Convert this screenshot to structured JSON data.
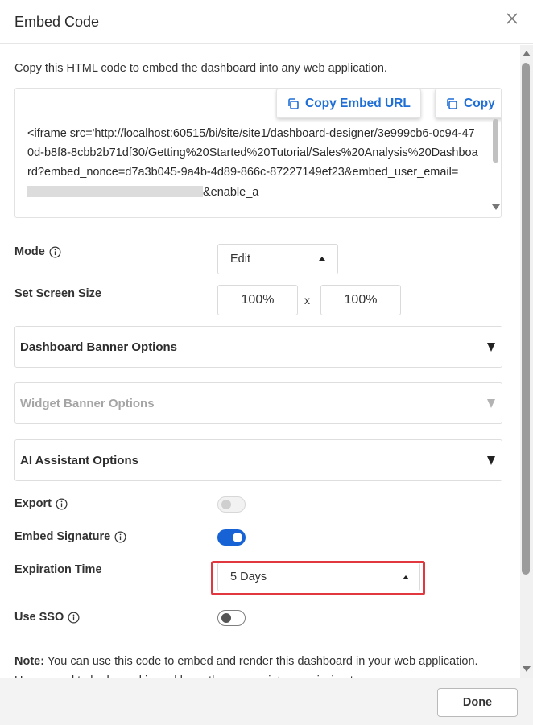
{
  "dialog": {
    "title": "Embed Code",
    "close_icon": "close-icon"
  },
  "description": "Copy this HTML code to embed the dashboard into any web application.",
  "code_box": {
    "code_text_before": "<iframe src='http://localhost:60515/bi/site/site1/dashboard-designer/3e999cb6-0c94-470d-b8f8-8cbb2b71df30/Getting%20Started%20Tutorial/Sales%20Analysis%20Dashboard?embed_nonce=d7a3b045-9a4b-4d89-866c-87227149ef23&embed_user_email=",
    "code_text_after": "&enable_a",
    "copy_url_label": "Copy Embed URL",
    "copy_code_label": "Copy",
    "copy_icon": "copy-icon"
  },
  "mode": {
    "label": "Mode",
    "value": "Edit",
    "info_icon": "info-icon"
  },
  "screen_size": {
    "label": "Set Screen Size",
    "width": "100%",
    "separator": "x",
    "height": "100%"
  },
  "panels": {
    "dashboard_banner": "Dashboard Banner Options",
    "widget_banner": "Widget Banner Options",
    "ai_assistant": "AI Assistant Options"
  },
  "export": {
    "label": "Export",
    "enabled": false,
    "disabled": true
  },
  "embed_signature": {
    "label": "Embed Signature",
    "enabled": true
  },
  "expiration": {
    "label": "Expiration Time",
    "value": "5 Days"
  },
  "use_sso": {
    "label": "Use SSO",
    "enabled": false
  },
  "note": {
    "prefix": "Note:",
    "text": " You can use this code to embed and render this dashboard in your web application. Users need to be logged in and have the appropriate permission to"
  },
  "footer": {
    "done_label": "Done"
  },
  "colors": {
    "accent": "#1763d6",
    "link": "#1f6fd6",
    "highlight": "#e0383e"
  }
}
